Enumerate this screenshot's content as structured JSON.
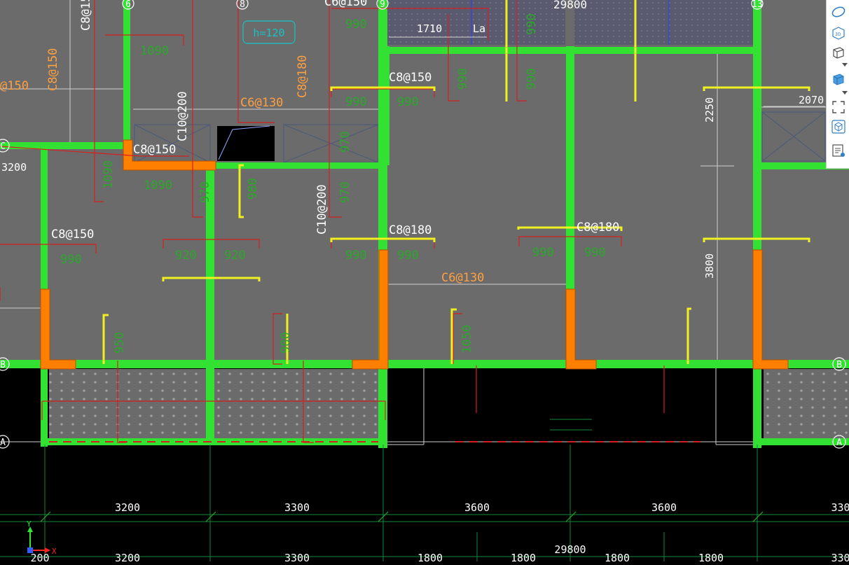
{
  "grid_axes": {
    "n6": "6",
    "n8": "8",
    "n9": "9",
    "n13": "13",
    "c": "C",
    "b": "B",
    "a": "A"
  },
  "rebar": {
    "c6_150_top": "C6@150",
    "c8_15_left": "C8@15",
    "c8_150_left": "@150",
    "c8_150_vert": "C8@150",
    "c8_180_vert": "C8@180",
    "c6_130_mid": "C6@130",
    "c10_200_a": "C10@200",
    "c8_150_mid": "C8@150",
    "c8_150_r9": "C8@150",
    "c8_150_lower": "C8@150",
    "c10_200_b": "C10@200",
    "c8_180_r9": "C8@180",
    "c8_180_r": "C8@180",
    "c6_130_low": "C6@130"
  },
  "slab_thickness": "h=120",
  "bar_lengths": {
    "l1090_a": "1090",
    "l1090_b": "1090",
    "l1090_c": "1090",
    "l990_a": "990",
    "l990_b": "990",
    "l990_c": "990",
    "l990_d": "990",
    "l990_e": "990",
    "l990_f": "990",
    "l990_g": "990",
    "l990_h": "990",
    "l990_v1": "990",
    "l990_v2": "990",
    "l990_v3": "990",
    "l970_a": "970",
    "l970_b": "970",
    "l970_c": "970",
    "l980": "980",
    "l950": "950",
    "l920_a": "920",
    "l920_b": "920",
    "l980_b": "980",
    "l1050": "1050",
    "la": "La"
  },
  "dimensions": {
    "d29800_top": "29800",
    "d1710": "1710",
    "d2250": "2250",
    "d2070": "2070",
    "d3800": "3800",
    "d3200_left": "3200",
    "row1": [
      "3200",
      "3300",
      "3600",
      "3600",
      "330"
    ],
    "total": "29800",
    "row2": [
      "200",
      "3200",
      "3300",
      "1800",
      "1800",
      "1800",
      "1800",
      "330"
    ]
  },
  "ucs": {
    "x": "X",
    "y": "Y"
  },
  "toolbar": {
    "items": [
      "freeform-orbit",
      "3D",
      "view-cube",
      "iso-view",
      "zoom-extents",
      "navigation-cube",
      "properties"
    ],
    "view3d_label": "3D"
  },
  "colors": {
    "wall": "#33e133",
    "orange": "#ff8000",
    "red": "#d42020",
    "yellow": "#f0f020",
    "green_text": "#2aa82a",
    "rebar_text": "#ffa040",
    "slab": "#6b6b6b"
  }
}
